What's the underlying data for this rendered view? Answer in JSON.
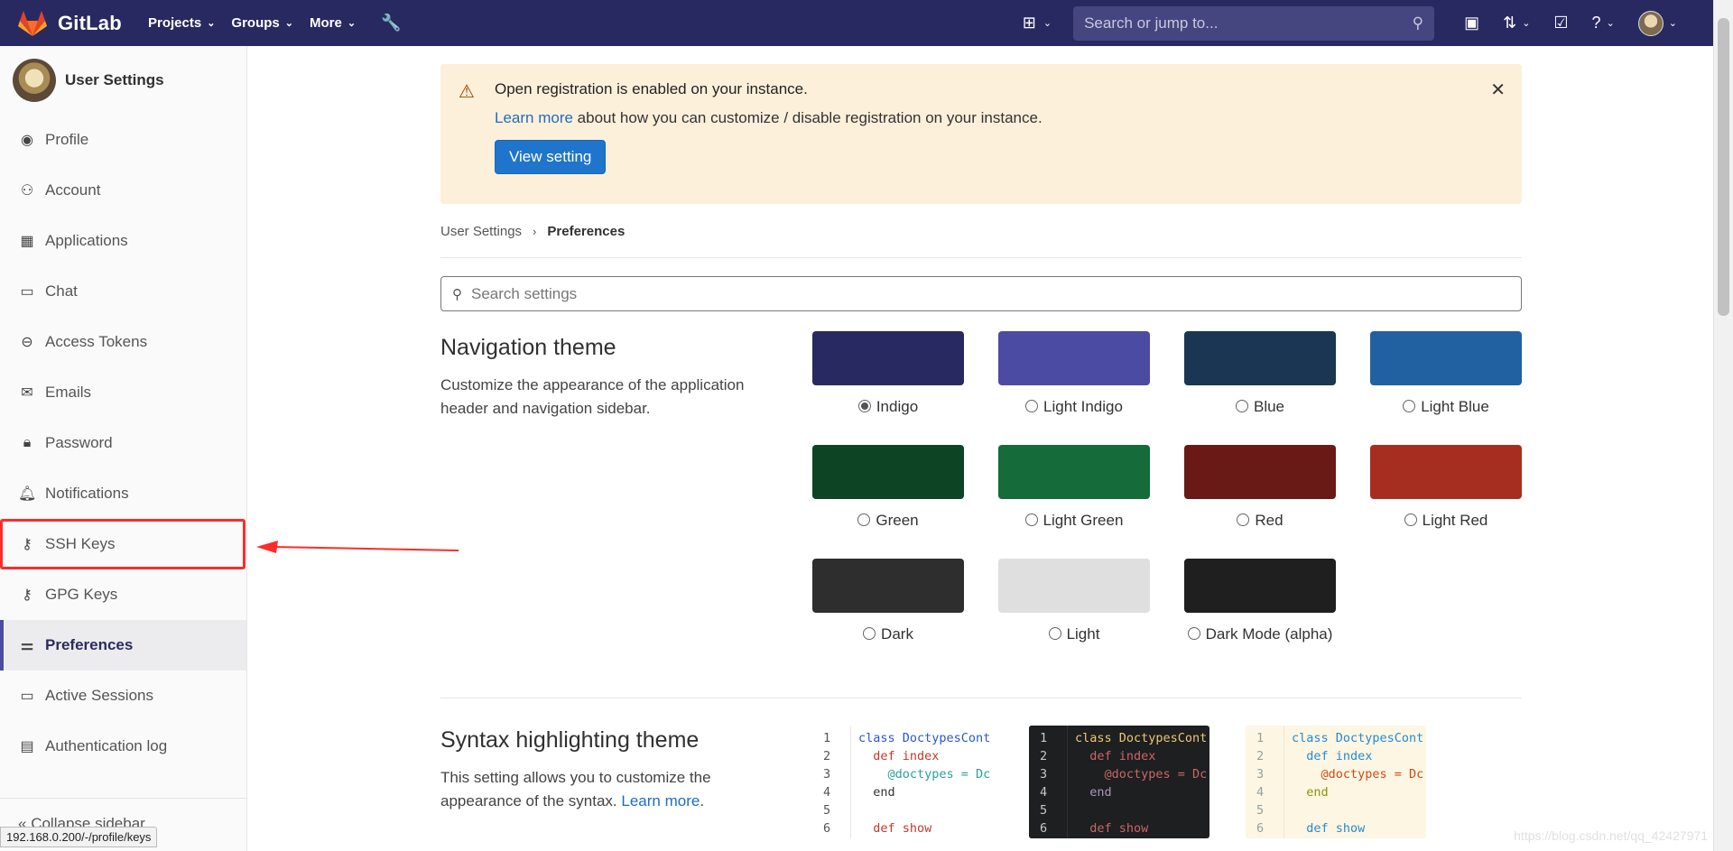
{
  "topbar": {
    "app_name": "GitLab",
    "nav": [
      {
        "label": "Projects"
      },
      {
        "label": "Groups"
      },
      {
        "label": "More"
      }
    ],
    "search_placeholder": "Search or jump to..."
  },
  "sidebar": {
    "title": "User Settings",
    "items": [
      {
        "label": "Profile",
        "icon": "profile-icon"
      },
      {
        "label": "Account",
        "icon": "account-icon"
      },
      {
        "label": "Applications",
        "icon": "applications-icon"
      },
      {
        "label": "Chat",
        "icon": "chat-icon"
      },
      {
        "label": "Access Tokens",
        "icon": "token-icon"
      },
      {
        "label": "Emails",
        "icon": "mail-icon"
      },
      {
        "label": "Password",
        "icon": "lock-icon"
      },
      {
        "label": "Notifications",
        "icon": "bell-icon"
      },
      {
        "label": "SSH Keys",
        "icon": "key-icon"
      },
      {
        "label": "GPG Keys",
        "icon": "key-icon"
      },
      {
        "label": "Preferences",
        "icon": "preferences-icon"
      },
      {
        "label": "Active Sessions",
        "icon": "monitor-icon"
      },
      {
        "label": "Authentication log",
        "icon": "log-icon"
      }
    ],
    "collapse_label": "Collapse sidebar"
  },
  "banner": {
    "title": "Open registration is enabled on your instance.",
    "link_text": "Learn more",
    "text": " about how you can customize / disable registration on your instance.",
    "button": "View setting"
  },
  "breadcrumb": {
    "parent": "User Settings",
    "current": "Preferences"
  },
  "settings_search_placeholder": "Search settings",
  "navigation_theme": {
    "heading": "Navigation theme",
    "description": "Customize the appearance of the application header and navigation sidebar.",
    "themes": [
      {
        "label": "Indigo",
        "color": "#292961",
        "selected": true
      },
      {
        "label": "Light Indigo",
        "color": "#4b4ba3",
        "selected": false
      },
      {
        "label": "Blue",
        "color": "#1a3652",
        "selected": false
      },
      {
        "label": "Light Blue",
        "color": "#2261a1",
        "selected": false
      },
      {
        "label": "Green",
        "color": "#0d4524",
        "selected": false
      },
      {
        "label": "Light Green",
        "color": "#156b39",
        "selected": false
      },
      {
        "label": "Red",
        "color": "#691a16",
        "selected": false
      },
      {
        "label": "Light Red",
        "color": "#a62e21",
        "selected": false
      },
      {
        "label": "Dark",
        "color": "#2e2e2e",
        "selected": false
      },
      {
        "label": "Light",
        "color": "#dfdfdf",
        "selected": false
      },
      {
        "label": "Dark Mode (alpha)",
        "color": "#1f1f1f",
        "selected": false
      }
    ]
  },
  "syntax_theme": {
    "heading": "Syntax highlighting theme",
    "description": "This setting allows you to customize the appearance of the syntax.",
    "link_text": "Learn more",
    "link_suffix": ".",
    "samples": [
      {
        "style": "light",
        "line_numbers": [
          "1",
          "2",
          "3",
          "4",
          "5",
          "6"
        ]
      },
      {
        "style": "dark",
        "line_numbers": [
          "1",
          "2",
          "3",
          "4",
          "5",
          "6"
        ]
      },
      {
        "style": "sol",
        "line_numbers": [
          "1",
          "2",
          "3",
          "4",
          "5",
          "6"
        ]
      }
    ],
    "code_lines": [
      "class DoctypesCont",
      "  def index",
      "    @doctypes = Dc",
      "  end",
      "",
      "  def show"
    ]
  },
  "status_url": "192.168.0.200/-/profile/keys",
  "watermark": "https://blog.csdn.net/qq_42427971"
}
